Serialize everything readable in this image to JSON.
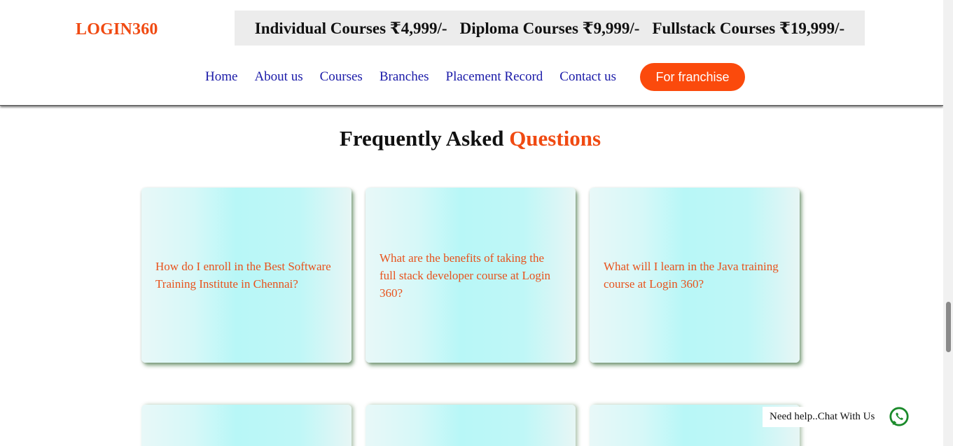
{
  "header": {
    "logo": "LOGIN360",
    "prices": [
      "Individual Courses ₹4,999/-",
      "Diploma Courses ₹9,999/-",
      "Fullstack Courses ₹19,999/-"
    ],
    "nav": [
      "Home",
      "About us",
      "Courses",
      "Branches",
      "Placement Record",
      "Contact us"
    ],
    "franchise_button": "For franchise"
  },
  "faq": {
    "title_main": "Frequently Asked",
    "title_accent": "Questions",
    "questions": [
      "How do I enroll in the Best Software Training Institute in Chennai?",
      "What are the benefits of taking the full stack developer course at Login 360?",
      "What will I learn in the Java training course at Login 360?"
    ]
  },
  "chat": {
    "label": "Need help..Chat With Us",
    "icon": "whatsapp-icon"
  },
  "colors": {
    "brand": "#f04a12",
    "button": "#fb4a0c",
    "nav_link": "#1a1aa8",
    "whatsapp": "#1a8a2a"
  }
}
